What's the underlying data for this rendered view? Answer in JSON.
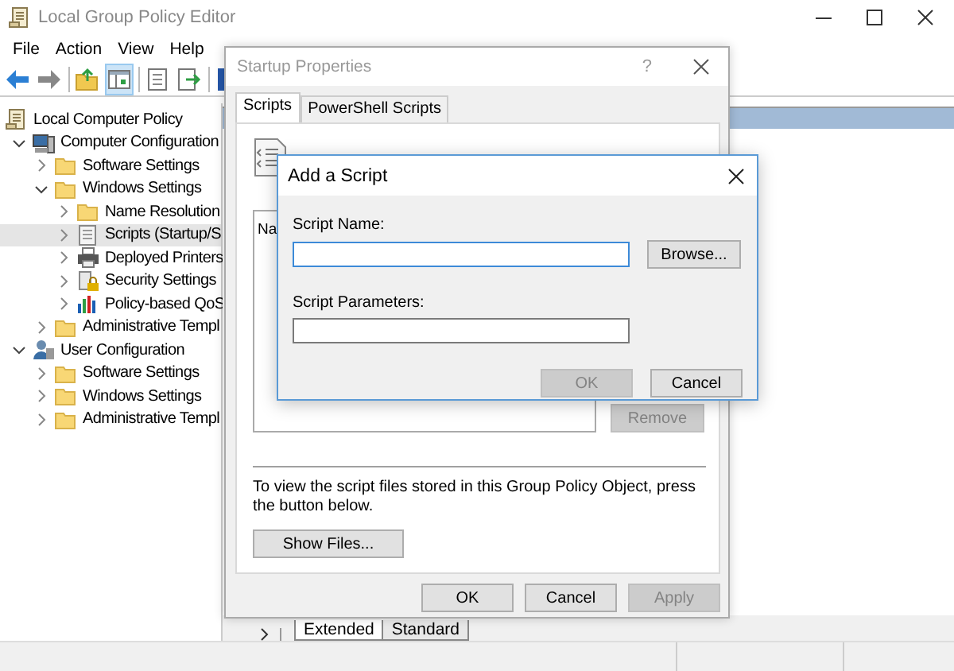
{
  "main_window": {
    "title": "Local Group Policy Editor",
    "menu": [
      "File",
      "Action",
      "View",
      "Help"
    ],
    "toolbar": [
      {
        "kind": "back",
        "pressed": false
      },
      {
        "kind": "forward",
        "pressed": false
      },
      {
        "kind": "separator"
      },
      {
        "kind": "up",
        "pressed": false
      },
      {
        "kind": "tree",
        "pressed": true
      },
      {
        "kind": "separator"
      },
      {
        "kind": "properties",
        "pressed": false
      },
      {
        "kind": "export",
        "pressed": false
      },
      {
        "kind": "separator"
      },
      {
        "kind": "help"
      }
    ],
    "tree": [
      {
        "label": "Local Computer Policy",
        "kind": "policy",
        "selected": false,
        "children": [
          {
            "label": "Computer Configuration",
            "kind": "computer",
            "expanded": true,
            "selected": false,
            "children": [
              {
                "label": "Software Settings",
                "kind": "folder",
                "expanded": false,
                "selected": false
              },
              {
                "label": "Windows Settings",
                "kind": "folder",
                "expanded": true,
                "selected": false,
                "children": [
                  {
                    "label": "Name Resolution",
                    "kind": "folder",
                    "expanded": false,
                    "selected": false
                  },
                  {
                    "label": "Scripts (Startup/S",
                    "kind": "scripts",
                    "expanded": false,
                    "selected": true
                  },
                  {
                    "label": "Deployed Printers",
                    "kind": "printer",
                    "expanded": false,
                    "selected": false
                  },
                  {
                    "label": "Security Settings",
                    "kind": "security",
                    "expanded": false,
                    "selected": false
                  },
                  {
                    "label": "Policy-based QoS",
                    "kind": "qos",
                    "expanded": false,
                    "selected": false
                  }
                ]
              },
              {
                "label": "Administrative Templ",
                "kind": "folder",
                "expanded": false,
                "selected": false
              }
            ]
          },
          {
            "label": "User Configuration",
            "kind": "user",
            "expanded": true,
            "selected": false,
            "children": [
              {
                "label": "Software Settings",
                "kind": "folder",
                "expanded": false,
                "selected": false
              },
              {
                "label": "Windows Settings",
                "kind": "folder",
                "expanded": false,
                "selected": false
              },
              {
                "label": "Administrative Templ",
                "kind": "folder",
                "expanded": false,
                "selected": false
              }
            ]
          }
        ]
      }
    ],
    "view_tabs": [
      {
        "label": "Extended",
        "selected": true
      },
      {
        "label": "Standard",
        "selected": false
      }
    ]
  },
  "startup_dialog": {
    "title": "Startup Properties",
    "help": "?",
    "tabs": [
      {
        "label": "Scripts",
        "selected": true
      },
      {
        "label": "PowerShell Scripts",
        "selected": false
      }
    ],
    "list_column": "Na",
    "remove_button": {
      "label": "Remove",
      "disabled": true
    },
    "note": "To view the script files stored in this Group Policy Object, press the button below.",
    "show_files_button": "Show Files...",
    "buttons": [
      {
        "label": "OK",
        "disabled": false
      },
      {
        "label": "Cancel",
        "disabled": false
      },
      {
        "label": "Apply",
        "disabled": true
      }
    ]
  },
  "add_dialog": {
    "title": "Add a Script",
    "fields": [
      {
        "label": "Script Name:",
        "focused": true
      },
      {
        "label": "Script Parameters:",
        "focused": false
      }
    ],
    "browse_button": "Browse...",
    "buttons": [
      {
        "label": "OK",
        "disabled": true
      },
      {
        "label": "Cancel",
        "disabled": false
      }
    ]
  }
}
